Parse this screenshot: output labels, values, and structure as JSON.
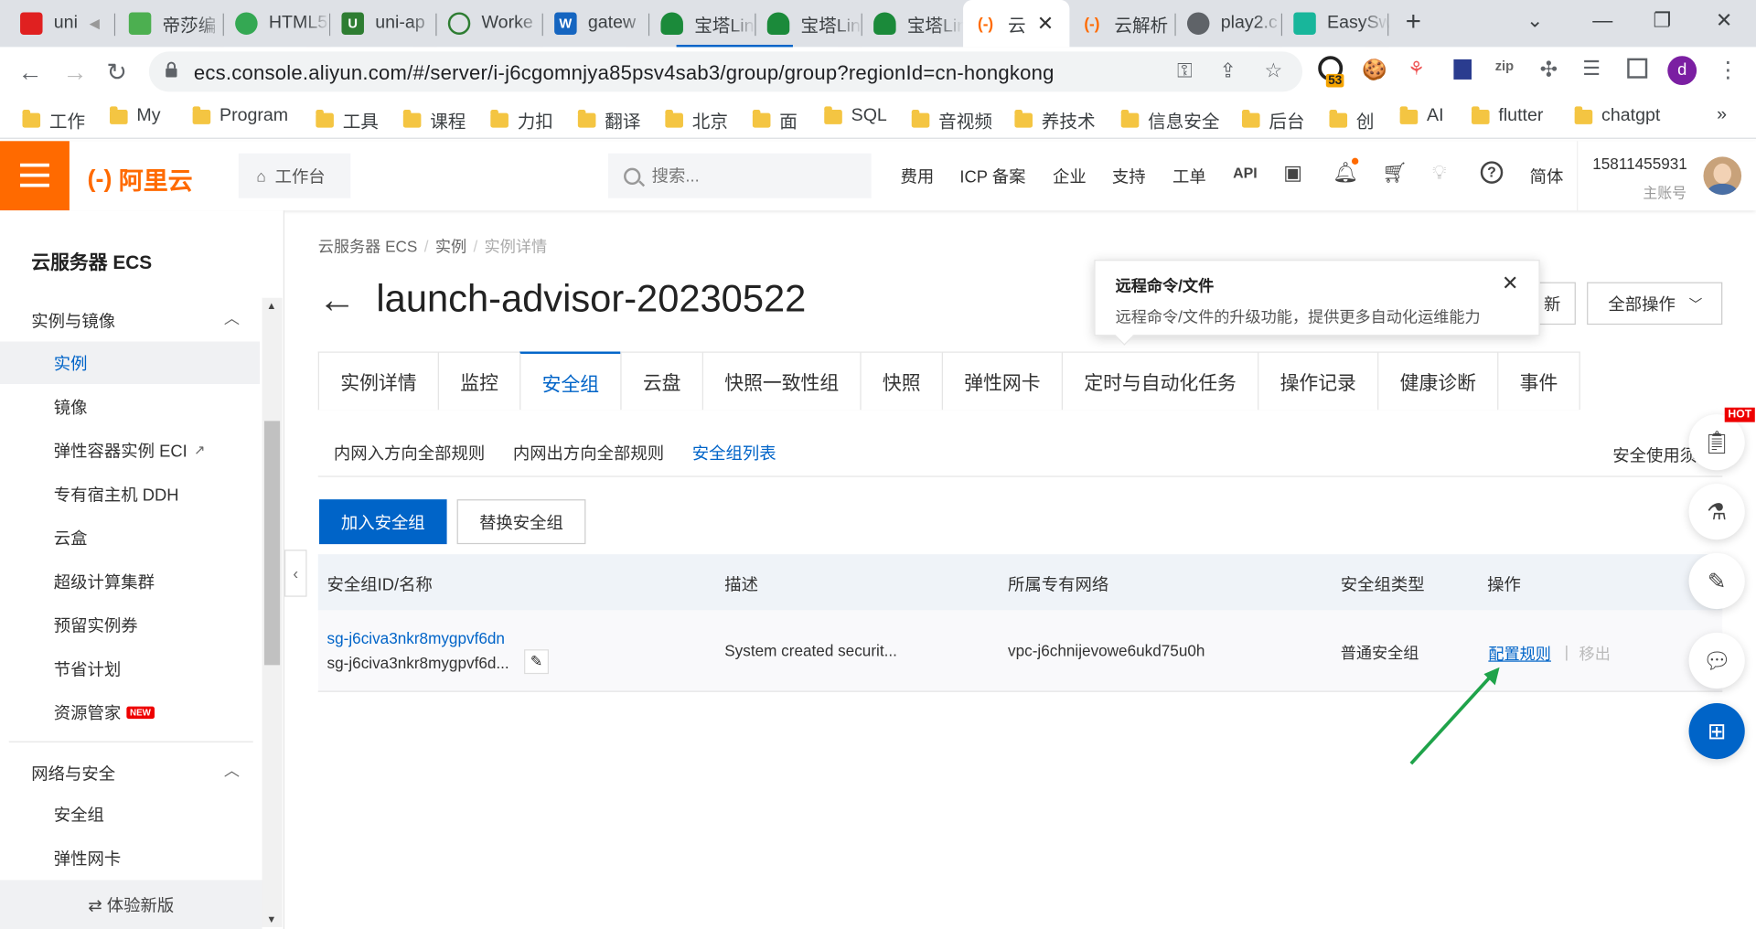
{
  "browser": {
    "tabs": [
      {
        "label": "uni",
        "color": "#e02020"
      },
      {
        "label": "帝莎编",
        "color": "#4caf50"
      },
      {
        "label": "HTML5",
        "color": "#34a853"
      },
      {
        "label": "uni-ap",
        "color": "#2e7d32"
      },
      {
        "label": "Worke",
        "color": "#2e7d32"
      },
      {
        "label": "gatew",
        "color": "#1565c0"
      },
      {
        "label": "宝塔Lin",
        "color": "#1b8a3a"
      },
      {
        "label": "宝塔Lin",
        "color": "#1b8a3a"
      },
      {
        "label": "宝塔Lin",
        "color": "#1b8a3a"
      },
      {
        "label": "云",
        "color": "#ff6a00"
      },
      {
        "label": "云解析",
        "color": "#ff6a00"
      },
      {
        "label": "play2.c",
        "color": "#5f6368"
      },
      {
        "label": "EasySw",
        "color": "#18b69b"
      }
    ],
    "url": "ecs.console.aliyun.com/#/server/i-j6cgomnjya85psv4sab3/group/group?regionId=cn-hongkong",
    "extension_badge": "53",
    "profile_letter": "d",
    "bookmarks": [
      "工作",
      "My",
      "Program",
      "工具",
      "课程",
      "力扣",
      "翻译",
      "北京",
      "面",
      "SQL",
      "音视频",
      "养技术",
      "信息安全",
      "后台",
      "创",
      "AI",
      "flutter",
      "chatgpt"
    ],
    "bookmarks_more": "»"
  },
  "topbar": {
    "logo_bracket": "(-)",
    "logo_text": "阿里云",
    "worktable": "工作台",
    "search_placeholder": "搜索...",
    "links": [
      "费用",
      "ICP 备案",
      "企业",
      "支持",
      "工单"
    ],
    "lang": "简体",
    "account_phone": "15811455931",
    "account_role": "主账号"
  },
  "sidebar": {
    "title": "云服务器 ECS",
    "group1": "实例与镜像",
    "items": [
      {
        "label": "实例",
        "active": true
      },
      {
        "label": "镜像"
      },
      {
        "label": "弹性容器实例 ECI",
        "external": true
      },
      {
        "label": "专有宿主机 DDH"
      },
      {
        "label": "云盒"
      },
      {
        "label": "超级计算集群"
      },
      {
        "label": "预留实例券"
      },
      {
        "label": "节省计划"
      },
      {
        "label": "资源管家",
        "badge": "NEW"
      }
    ],
    "group2": "网络与安全",
    "items2": [
      {
        "label": "安全组"
      },
      {
        "label": "弹性网卡"
      }
    ],
    "bottom": "⇄ 体验新版"
  },
  "breadcrumb": [
    "云服务器 ECS",
    "实例",
    "实例详情"
  ],
  "page_title": "launch-advisor-20230522",
  "popover": {
    "title": "远程命令/文件",
    "desc": "远程命令/文件的升级功能，提供更多自动化运维能力"
  },
  "head_buttons": {
    "refresh": "新",
    "all_actions": "全部操作"
  },
  "tabs": [
    "实例详情",
    "监控",
    "安全组",
    "云盘",
    "快照一致性组",
    "快照",
    "弹性网卡",
    "定时与自动化任务",
    "操作记录",
    "健康诊断",
    "事件"
  ],
  "active_tab": "安全组",
  "subtabs": [
    "内网入方向全部规则",
    "内网出方向全部规则",
    "安全组列表"
  ],
  "active_subtab": "安全组列表",
  "notice": "安全使用须",
  "buttons": {
    "join": "加入安全组",
    "replace": "替换安全组"
  },
  "table": {
    "columns": [
      "安全组ID/名称",
      "描述",
      "所属专有网络",
      "安全组类型",
      "操作"
    ],
    "rows": [
      {
        "id": "sg-j6civa3nkr8mygpvf6dn",
        "name": "sg-j6civa3nkr8mygpvf6d...",
        "desc": "System created securit...",
        "vpc": "vpc-j6chnijevowe6ukd75u0h",
        "type": "普通安全组",
        "action_config": "配置规则",
        "action_sep": "|",
        "action_remove": "移出"
      }
    ]
  },
  "float": {
    "hot": "HOT"
  },
  "accent": "#0064c8",
  "brand": "#ff6a00"
}
